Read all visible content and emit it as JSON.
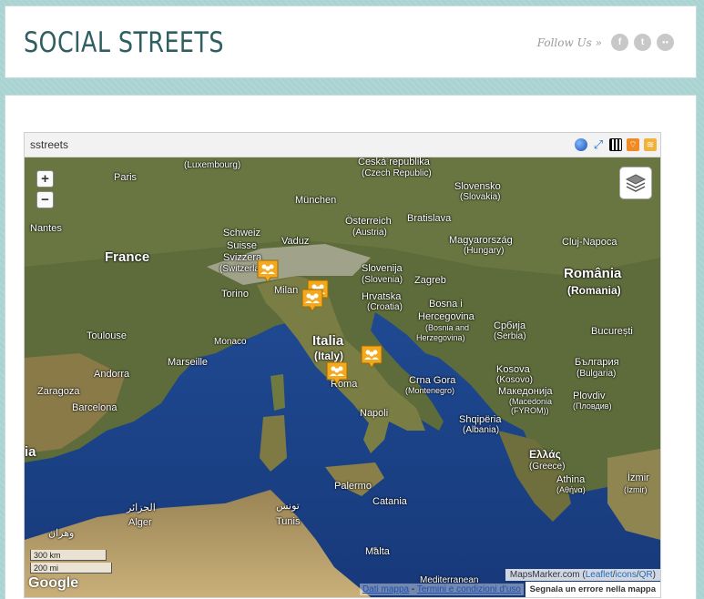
{
  "header": {
    "site_title": "SOCIAL STREETS",
    "follow_label": "Follow Us »",
    "social": [
      {
        "icon": "facebook-icon",
        "glyph": "f"
      },
      {
        "icon": "twitter-icon",
        "glyph": "t"
      },
      {
        "icon": "flickr-icon",
        "glyph": "●●"
      }
    ]
  },
  "widget": {
    "title": "sstreets",
    "header_icons": [
      "google-earth-icon",
      "fullscreen-icon",
      "qr-code-icon",
      "rss-feed-icon",
      "geo-rss-icon"
    ]
  },
  "map": {
    "zoom_in": "+",
    "zoom_out": "−",
    "labels": {
      "luxembourg": "(Luxembourg)",
      "ceska": "Česká republika",
      "ceska_sub": "(Czech Republic)",
      "paris": "Paris",
      "slovensko": "Slovensko",
      "slovensko_sub": "(Slovakia)",
      "munchen": "München",
      "osterreich": "Österreich",
      "osterreich_sub": "(Austria)",
      "bratislava": "Bratislava",
      "nantes": "Nantes",
      "schweiz": "Schweiz",
      "suisse": "Suisse",
      "svizzera": "Svizzera",
      "switzerland": "(Switzerland)",
      "vaduz": "Vaduz",
      "magyarorszag": "Magyarország",
      "magyarorszag_sub": "(Hungary)",
      "cluj": "Cluj-Napoca",
      "france": "France",
      "slovenija": "Slovenija",
      "slovenia": "(Slovenia)",
      "romania": "România",
      "romania_sub": "(Romania)",
      "torino": "Torino",
      "milano": "Milan",
      "zagreb": "Zagreb",
      "hrvatska": "Hrvatska",
      "croatia": "(Croatia)",
      "bosna": "Bosna i",
      "hercegovina": "Hercegovina",
      "bosnia": "(Bosnia and",
      "herzegovina": "Herzegovina)",
      "srbija": "Србија",
      "serbia": "(Serbia)",
      "toulouse": "Toulouse",
      "monaco": "Monaco",
      "italia": "Italia",
      "italy": "(Italy)",
      "bucuresti": "București",
      "marseille": "Marseille",
      "andorra": "Andorra",
      "kosova": "Kosova",
      "kosovo": "(Kosovo)",
      "bulgaria": "България",
      "bulgaria_sub": "(Bulgaria)",
      "crna_gora": "Crna Gora",
      "montenegro": "(Montenegro)",
      "zaragoza": "Zaragoza",
      "roma": "Roma",
      "makedonija": "Македонија",
      "macedonia": "(Macedonia",
      "fyrom": "(FYROM))",
      "plovdiv": "Plovdiv",
      "plovdiv_bg": "(Пловдив)",
      "barcelona": "Barcelona",
      "napoli": "Napoli",
      "shqiperia": "Shqipëria",
      "albania": "(Albania)",
      "ia": "ia",
      "ellada": "Ελλάς",
      "greece": "(Greece)",
      "athina": "Athina",
      "athina_gr": "(Αθήνα)",
      "izmir": "İzmir",
      "izmir_tr": "(İzmir)",
      "palermo": "Palermo",
      "catania": "Catania",
      "al_jazair": "الجزائر",
      "alger": "Alger",
      "tunis_ar": "تونس",
      "tunis": "Tunis",
      "wahran": "وهران",
      "malta": "Malta",
      "mediterranean": "Mediterranean"
    },
    "scale": [
      "300 km",
      "200 mi"
    ],
    "google_logo": "Google",
    "credit_prefix": "MapsMarker.com (",
    "credit_links": [
      "Leaflet",
      "icons",
      "QR"
    ],
    "credit_suffix": ")",
    "attrib_link1": "Dati mappa",
    "attrib_sep": " - ",
    "attrib_link2": "Termini e condizioni d'uso",
    "report": "Segnala un errore nella mappa"
  }
}
